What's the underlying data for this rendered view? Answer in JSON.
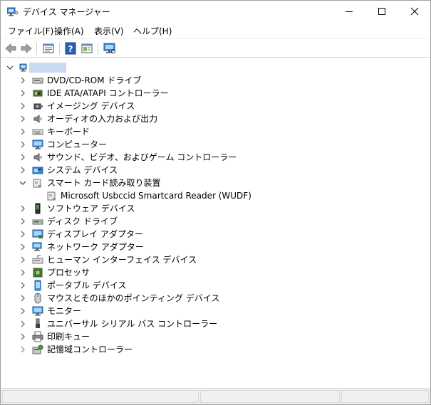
{
  "window": {
    "title": "デバイス マネージャー"
  },
  "menu": [
    "ファイル(F)",
    "操作(A)",
    "表示(V)",
    "ヘルプ(H)"
  ],
  "tree": {
    "root_label": "",
    "items": [
      {
        "label": "DVD/CD-ROM ドライブ",
        "icon": "dvd-drive-icon"
      },
      {
        "label": "IDE ATA/ATAPI コントローラー",
        "icon": "ide-controller-icon"
      },
      {
        "label": "イメージング デバイス",
        "icon": "camera-icon"
      },
      {
        "label": "オーディオの入力および出力",
        "icon": "speaker-icon"
      },
      {
        "label": "キーボード",
        "icon": "keyboard-icon"
      },
      {
        "label": "コンピューター",
        "icon": "computer-icon"
      },
      {
        "label": "サウンド、ビデオ、およびゲーム コントローラー",
        "icon": "speaker-icon"
      },
      {
        "label": "システム デバイス",
        "icon": "system-device-icon"
      },
      {
        "label": "スマート カード読み取り装置",
        "icon": "smartcard-reader-icon",
        "expanded": true
      },
      {
        "label": "Microsoft Usbccid Smartcard Reader (WUDF)",
        "icon": "smartcard-reader-icon",
        "child": true
      },
      {
        "label": "ソフトウェア デバイス",
        "icon": "software-device-icon"
      },
      {
        "label": "ディスク ドライブ",
        "icon": "disk-drive-icon"
      },
      {
        "label": "ディスプレイ アダプター",
        "icon": "display-adapter-icon"
      },
      {
        "label": "ネットワーク アダプター",
        "icon": "network-adapter-icon"
      },
      {
        "label": "ヒューマン インターフェイス デバイス",
        "icon": "hid-icon"
      },
      {
        "label": "プロセッサ",
        "icon": "processor-icon"
      },
      {
        "label": "ポータブル デバイス",
        "icon": "portable-device-icon"
      },
      {
        "label": "マウスとそのほかのポインティング デバイス",
        "icon": "mouse-icon"
      },
      {
        "label": "モニター",
        "icon": "monitor-icon"
      },
      {
        "label": "ユニバーサル シリアル バス コントローラー",
        "icon": "usb-icon"
      },
      {
        "label": "印刷キュー",
        "icon": "printer-icon"
      },
      {
        "label": "記憶域コントローラー",
        "icon": "storage-controller-icon"
      }
    ]
  }
}
